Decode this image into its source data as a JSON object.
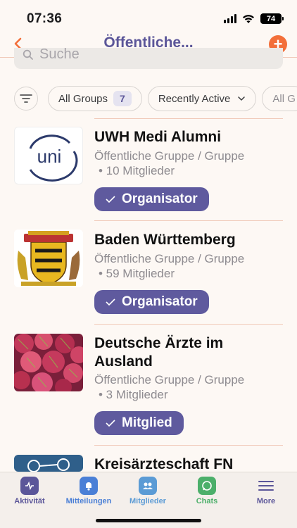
{
  "status": {
    "time": "07:36",
    "battery": "74"
  },
  "nav": {
    "title": "Öffentliche..."
  },
  "search": {
    "placeholder": "Suche"
  },
  "filters": {
    "groups_label": "All Groups",
    "groups_count": "7",
    "sort_label": "Recently Active",
    "extra_label": "All G"
  },
  "groups": [
    {
      "name": "UWH Medi Alumni",
      "type": "Öffentliche Gruppe / Gruppe",
      "members": "• 10 Mitglieder",
      "role": "Organisator",
      "thumb_text": "uni"
    },
    {
      "name": "Baden Württemberg",
      "type": "Öffentliche Gruppe / Gruppe",
      "members": "• 59 Mitglieder",
      "role": "Organisator"
    },
    {
      "name": "Deutsche Ärzte im Ausland",
      "type": "Öffentliche Gruppe / Gruppe",
      "members": "• 3 Mitglieder",
      "role": "Mitglied"
    },
    {
      "name": "Kreisärzteschaft FN"
    }
  ],
  "tabs": [
    {
      "label": "Aktivität",
      "color": "#5b5699",
      "icon": "activity-icon"
    },
    {
      "label": "Mitteilungen",
      "color": "#4a7fd6",
      "icon": "bell-icon"
    },
    {
      "label": "Mitglieder",
      "color": "#5b9bd5",
      "icon": "members-icon"
    },
    {
      "label": "Chats",
      "color": "#4caf6a",
      "icon": "chat-icon"
    },
    {
      "label": "More",
      "color": "#5b5699",
      "icon": "menu-icon"
    }
  ],
  "colors": {
    "accent": "#5f5a9e",
    "orange": "#f36f3a",
    "background": "#fdf8f4"
  }
}
